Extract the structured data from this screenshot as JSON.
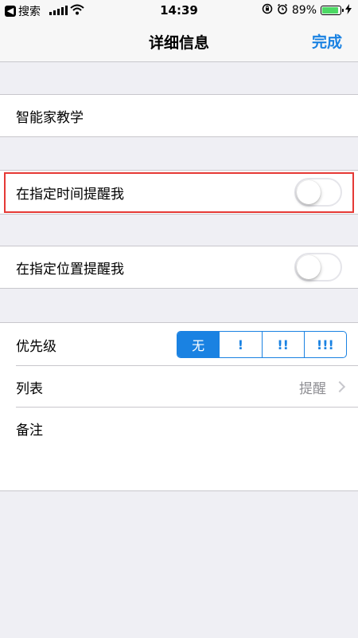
{
  "status_bar": {
    "back_app": "搜索",
    "time": "14:39",
    "battery": "89%",
    "battery_level": 0.89,
    "icons": [
      "back-arrow-icon",
      "signal-icon",
      "wifi-icon",
      "orientation-lock-icon",
      "alarm-icon",
      "battery-icon",
      "charging-icon"
    ]
  },
  "nav": {
    "title": "详细信息",
    "done_label": "完成"
  },
  "task": {
    "title": "智能家教学"
  },
  "reminders": {
    "time_label": "在指定时间提醒我",
    "time_on": false,
    "location_label": "在指定位置提醒我",
    "location_on": false
  },
  "details": {
    "priority_label": "优先级",
    "priority_options": [
      "无",
      "!",
      "!!",
      "!!!"
    ],
    "priority_selected": "无",
    "list_label": "列表",
    "list_value": "提醒",
    "notes_label": "备注"
  },
  "colors": {
    "accent": "#1a82e2",
    "highlight": "#e53935",
    "background": "#efeff4"
  }
}
